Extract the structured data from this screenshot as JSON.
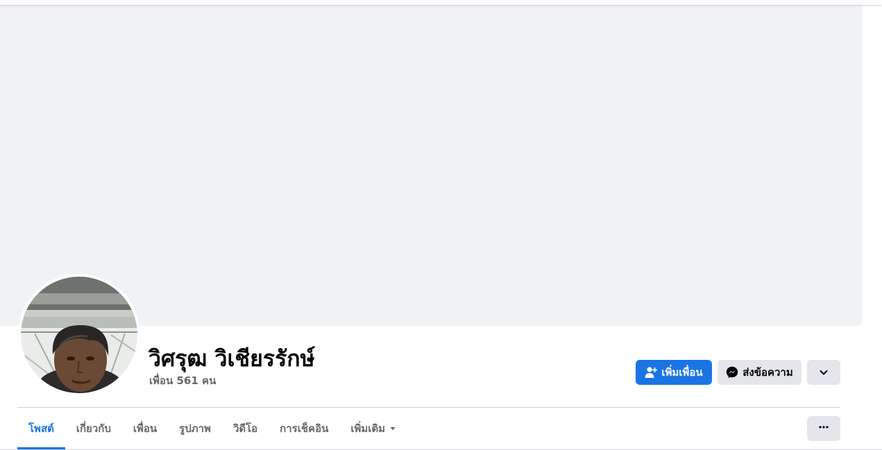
{
  "profile": {
    "name": "วิศรุฒ วิเชียรรักษ์",
    "friends": "เพื่อน 561 คน"
  },
  "actions": {
    "add_friend": "เพิ่มเพื่อน",
    "message": "ส่งข้อความ"
  },
  "tabs": [
    {
      "label": "โพสต์",
      "active": true
    },
    {
      "label": "เกี่ยวกับ",
      "active": false
    },
    {
      "label": "เพื่อน",
      "active": false
    },
    {
      "label": "รูปภาพ",
      "active": false
    },
    {
      "label": "วิดีโอ",
      "active": false
    },
    {
      "label": "การเช็คอิน",
      "active": false
    },
    {
      "label": "เพิ่มเติม",
      "active": false
    }
  ],
  "icons": {
    "add_friend": "user-plus-icon",
    "message": "messenger-icon",
    "more": "chevron-down-icon",
    "tab_more_caret": "caret-down-icon",
    "tab_options": "ellipsis-icon"
  },
  "colors": {
    "accent": "#1b74e4",
    "cover": "#f0f2f5",
    "secondary_button": "#e4e6eb",
    "muted_text": "#65676b"
  }
}
